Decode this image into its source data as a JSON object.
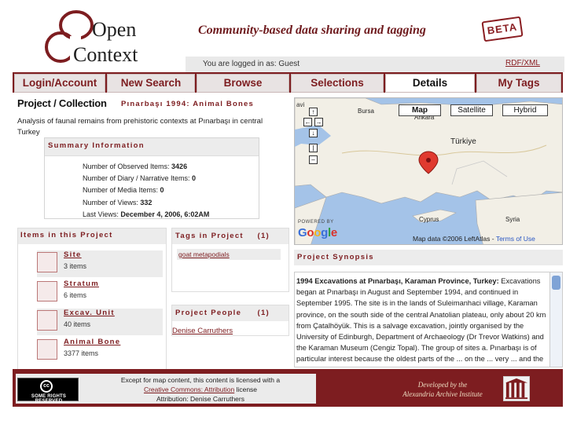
{
  "header": {
    "logo_line1": "Open",
    "logo_line2": "Context",
    "tagline": "Community-based data sharing and tagging",
    "beta": "BETA",
    "logged_in": "You are logged in as: Guest",
    "rdf_link": "RDF/XML"
  },
  "nav": {
    "tabs": [
      {
        "label": "Login/Account",
        "active": false
      },
      {
        "label": "New Search",
        "active": false
      },
      {
        "label": "Browse",
        "active": false
      },
      {
        "label": "Selections",
        "active": false
      },
      {
        "label": "Details",
        "active": true
      },
      {
        "label": "My Tags",
        "active": false
      }
    ]
  },
  "project": {
    "heading": "Project / Collection",
    "title": "Pınarbaşı 1994: Animal Bones",
    "description": "Analysis of faunal remains from prehistoric contexts at Pınarbaşı in central Turkey"
  },
  "summary": {
    "heading": "Summary Information",
    "lines": [
      {
        "label": "Number of Observed Items: ",
        "value": "3426"
      },
      {
        "label": "Number of Diary / Narrative Items: ",
        "value": "0"
      },
      {
        "label": "Number of Media Items: ",
        "value": "0"
      },
      {
        "label": "Number of Views: ",
        "value": "332"
      },
      {
        "label": "Last Views: ",
        "value": "December 4, 2006, 6:02AM"
      }
    ]
  },
  "items_panel": {
    "heading": "Items in this Project",
    "items": [
      {
        "name": "Site",
        "count": "3 items"
      },
      {
        "name": "Stratum",
        "count": "6 items"
      },
      {
        "name": "Excav. Unit",
        "count": "40 items"
      },
      {
        "name": "Animal Bone",
        "count": "3377 items"
      }
    ]
  },
  "tags_panel": {
    "heading": "Tags in Project",
    "count": "(1)",
    "tag": "goat metapodials"
  },
  "people_panel": {
    "heading": "Project People",
    "count": "(1)",
    "person": "Denise Carruthers"
  },
  "map": {
    "buttons": [
      "Map",
      "Satellite",
      "Hybrid"
    ],
    "selected": "Map",
    "labels": {
      "corner": "avi",
      "bursa": "Bursa",
      "ankara": "Ankara",
      "turkiye": "Türkiye",
      "cyprus": "Cyprus",
      "syria": "Syria"
    },
    "powered_by": "POWERED BY",
    "google": "Google",
    "attribution": "Map data ©2006 LeftAtlas - ",
    "terms": "Terms of Use",
    "colors": {
      "sea": "#a4c3e8",
      "land": "#f2efe6",
      "marker": "#e03a2f"
    }
  },
  "synopsis": {
    "heading": "Project Synopsis",
    "lead": "1994 Excavations at Pınarbaşı, Karaman Province, Turkey:",
    "body": " Excavations began at Pınarbaşı in August and September 1994, and continued in September 1995. The site is in the lands of Suleimanhaci village, Karaman province, on the south side of the central Anatolian plateau, only about 20 km from Çatalhöyük. This is a salvage excavation, jointly organised by the University of Edinburgh, Department of Archaeology (Dr Trevor Watkins) and the Karaman Museum (Cengiz Topal). The group of sites a. Pınarbaşı is of particular interest because the oldest parts of the ... on the ... very ... and the ..."
  },
  "footer": {
    "cc_label": "SOME RIGHTS RESERVED",
    "cc_symbol": "cc",
    "license_line1": "Except for map content, this content is licensed with a",
    "license_link": "Creative Commons: Attribution",
    "license_after": " license",
    "attribution": "Attribution: Denise Carruthers",
    "developed_line1": "Developed by the",
    "developed_line2": "Alexandria Archive Institute"
  }
}
